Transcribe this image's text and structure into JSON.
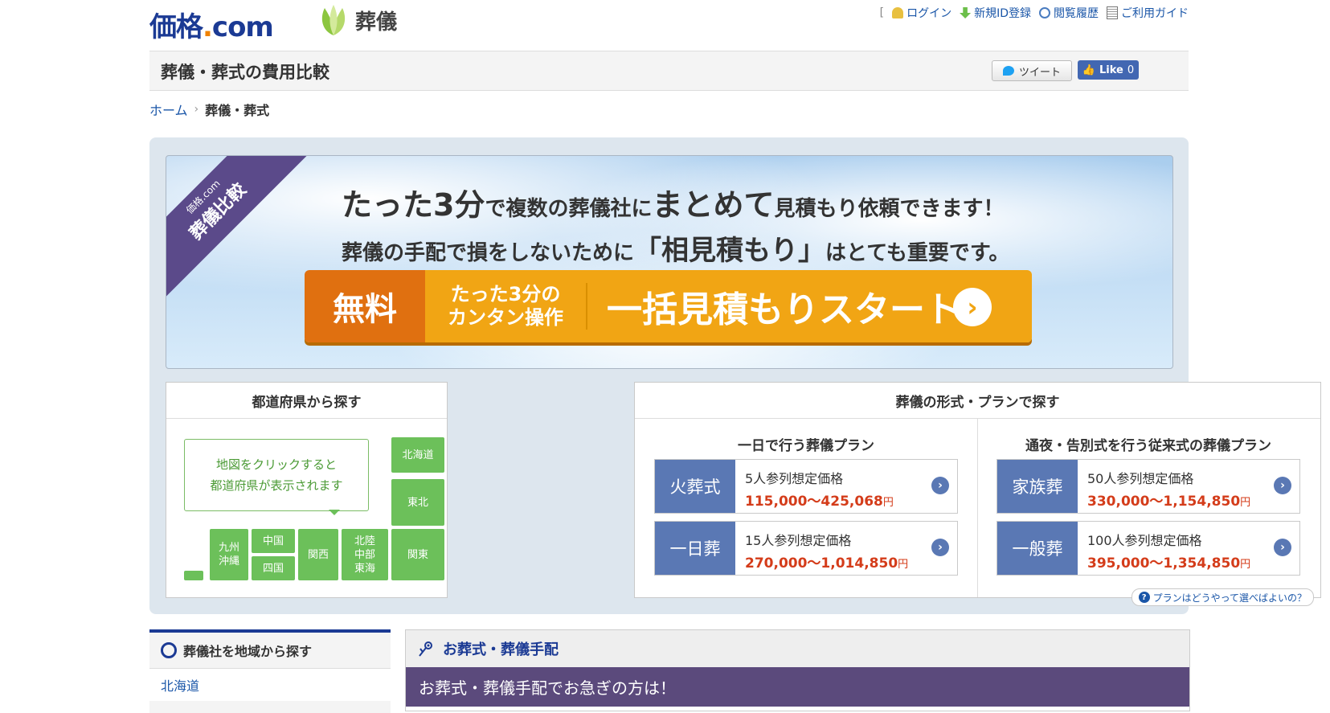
{
  "header": {
    "logo_main": "価格",
    "logo_dot": ".",
    "logo_com": "com",
    "sub_logo": "葬儀",
    "bracket": "[",
    "nav": [
      "ログイン",
      "新規ID登録",
      "閲覧履歴",
      "ご利用ガイド"
    ]
  },
  "titlebar": {
    "title": "葬儀・葬式の費用比較",
    "tweet": "ツイート",
    "like": "Like",
    "like_count": "0"
  },
  "breadcrumb": {
    "home": "ホーム",
    "sep": "›",
    "current": "葬儀・葬式"
  },
  "banner": {
    "ribbon_small": "価格.com",
    "ribbon_big": "葬儀比較",
    "line1_em1": "たった3分",
    "line1_a": "で複数の葬儀社に",
    "line1_em2": "まとめて",
    "line1_b": "見積もり依頼できます！",
    "line2_a": "葬儀の手配で損をしないために",
    "line2_em": "「相見積もり」",
    "line2_b": "はとても重要です。",
    "cta_free": "無料",
    "cta_easy_1": "たった3分の",
    "cta_easy_2": "カンタン操作",
    "cta_start": "一括見積もりスタート",
    "cta_arrow": "›"
  },
  "pref_box": {
    "title": "都道府県から探す",
    "hint_1": "地図をクリックすると",
    "hint_2": "都道府県が表示されます",
    "regions": {
      "hokkaido": "北海道",
      "tohoku": "東北",
      "kanto": "関東",
      "hokuriku": "北陸\n中部\n東海",
      "kansai": "関西",
      "chugoku": "中国",
      "shikoku": "四国",
      "kyushu": "九州\n沖縄"
    }
  },
  "plan_box": {
    "title": "葬儀の形式・プランで探す",
    "left_title": "一日で行う葬儀プラン",
    "right_title": "通夜・告別式を行う従来式の葬儀プラン",
    "cards": [
      {
        "label": "火葬式",
        "count": "5人参列想定価格",
        "price": "115,000〜425,068",
        "yen": "円"
      },
      {
        "label": "一日葬",
        "count": "15人参列想定価格",
        "price": "270,000〜1,014,850",
        "yen": "円"
      },
      {
        "label": "家族葬",
        "count": "50人参列想定価格",
        "price": "330,000〜1,154,850",
        "yen": "円"
      },
      {
        "label": "一般葬",
        "count": "100人参列想定価格",
        "price": "395,000〜1,354,850",
        "yen": "円"
      }
    ],
    "help": "プランはどうやって選べばよいの？",
    "help_q": "?"
  },
  "side": {
    "title": "葬儀社を地域から探す",
    "first": "北海道"
  },
  "main": {
    "title": "お葬式・葬儀手配",
    "urgent": "お葬式・葬儀手配でお急ぎの方は！"
  }
}
